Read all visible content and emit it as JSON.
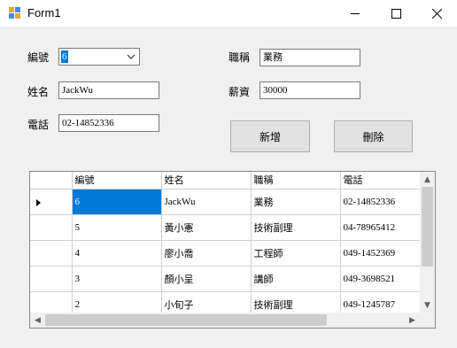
{
  "window": {
    "title": "Form1"
  },
  "form": {
    "id_label": "編號",
    "id_value": "6",
    "name_label": "姓名",
    "name_value": "JackWu",
    "phone_label": "電話",
    "phone_value": "02-14852336",
    "title_label": "職稱",
    "title_value": "業務",
    "salary_label": "薪資",
    "salary_value": "30000",
    "add_button": "新增",
    "delete_button": "刪除"
  },
  "grid": {
    "columns": [
      "編號",
      "姓名",
      "職稱",
      "電話"
    ],
    "rows": [
      [
        "6",
        "JackWu",
        "業務",
        "02-14852336"
      ],
      [
        "5",
        "黃小憲",
        "技術副理",
        "04-78965412"
      ],
      [
        "4",
        "廖小喬",
        "工程師",
        "049-1452369"
      ],
      [
        "3",
        "顏小呈",
        "講師",
        "049-3698521"
      ],
      [
        "2",
        "小旬子",
        "技術副理",
        "049-1245787"
      ]
    ]
  }
}
